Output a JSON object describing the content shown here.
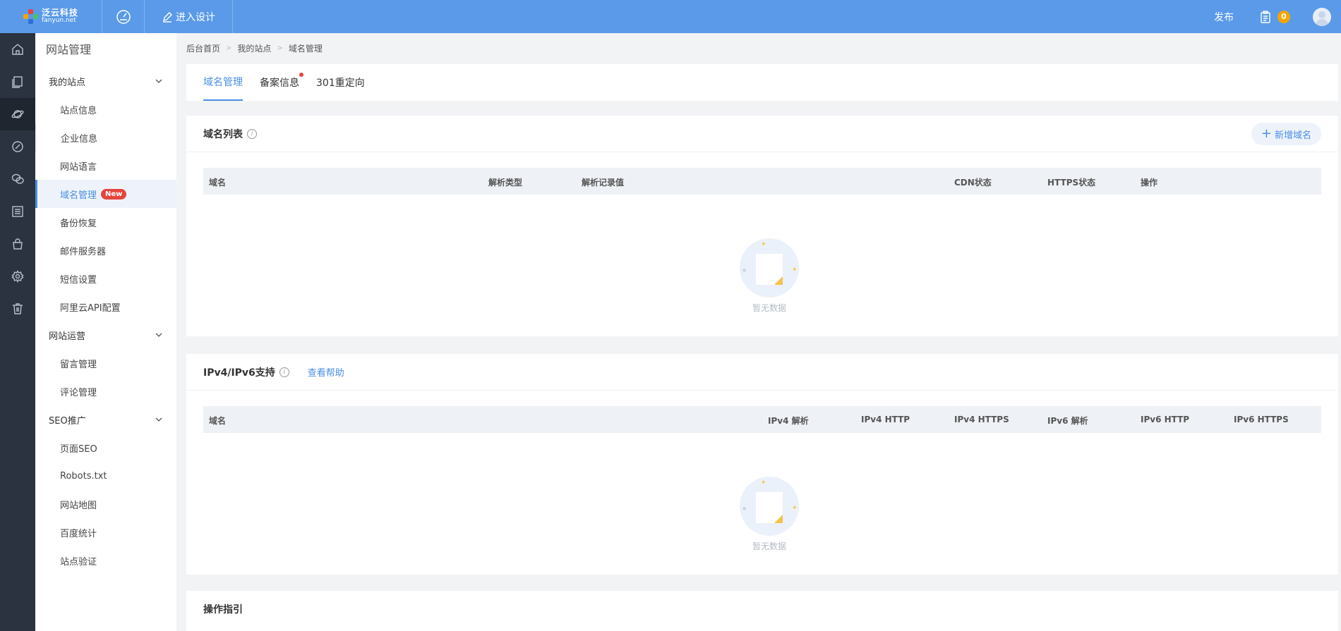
{
  "brand": {
    "name_cn": "泛云科技",
    "name_en": "fanyun.net"
  },
  "topbar": {
    "design_label": "进入设计",
    "publish_label": "发布",
    "task_count": "0"
  },
  "rail": {
    "icons": [
      "home-icon",
      "pages-icon",
      "planet-icon",
      "link-icon",
      "wechat-icon",
      "list-icon",
      "shop-bag-icon",
      "gear-icon",
      "trash-icon"
    ]
  },
  "menu": {
    "title": "网站管理",
    "groups": [
      {
        "label": "我的站点",
        "items": [
          "站点信息",
          "企业信息",
          "网站语言",
          "域名管理",
          "备份恢复",
          "邮件服务器",
          "短信设置",
          "阿里云API配置"
        ]
      },
      {
        "label": "网站运营",
        "items": [
          "留言管理",
          "评论管理"
        ]
      },
      {
        "label": "SEO推广",
        "items": [
          "页面SEO",
          "Robots.txt",
          "网站地图",
          "百度统计",
          "站点验证"
        ]
      }
    ],
    "new_badge": "New"
  },
  "breadcrumb": [
    "后台首页",
    "我的站点",
    "域名管理"
  ],
  "tabs": [
    "域名管理",
    "备案信息",
    "301重定向"
  ],
  "domain_card": {
    "title": "域名列表",
    "add_button": "新增域名",
    "columns": [
      "域名",
      "解析类型",
      "解析记录值",
      "CDN状态",
      "HTTPS状态",
      "操作"
    ],
    "empty_text": "暂无数据"
  },
  "ip_card": {
    "title": "IPv4/IPv6支持",
    "help_link": "查看帮助",
    "columns": [
      "域名",
      "IPv4 解析",
      "IPv4 HTTP",
      "IPv4 HTTPS",
      "IPv6 解析",
      "IPv6 HTTP",
      "IPv6 HTTPS"
    ],
    "empty_text": "暂无数据"
  },
  "guide_card": {
    "title": "操作指引"
  },
  "colors": {
    "topbar": "#5a9ae8",
    "accent": "#4a8ee4",
    "rail": "#2b3340",
    "badge_red": "#e5453d",
    "badge_orange": "#f7a400"
  }
}
